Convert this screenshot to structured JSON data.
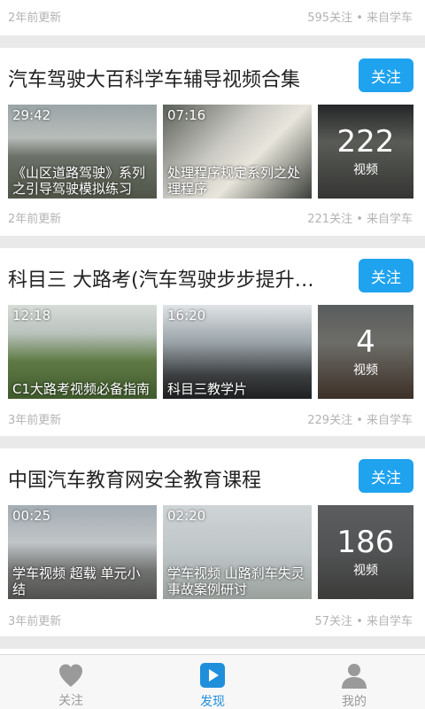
{
  "feed": {
    "top_partial": {
      "time": "2年前更新",
      "meta": "595关注 • 来自学车"
    },
    "cards": [
      {
        "title": "汽车驾驶大百科学车辅导视频合集",
        "follow_label": "关注",
        "videos": [
          {
            "duration": "29:42",
            "caption": "《山区道路驾驶》系列之引导驾驶模拟练习"
          },
          {
            "duration": "07:16",
            "caption": "处理程序规定系列之处理程序"
          }
        ],
        "count": {
          "number": "222",
          "label": "视频"
        },
        "time": "2年前更新",
        "meta": "221关注 • 来自学车"
      },
      {
        "title": "科目三 大路考(汽车驾驶步步提升…",
        "follow_label": "关注",
        "videos": [
          {
            "duration": "12:18",
            "caption": "C1大路考视频必备指南"
          },
          {
            "duration": "16:20",
            "caption": "科目三教学片"
          }
        ],
        "count": {
          "number": "4",
          "label": "视频"
        },
        "time": "3年前更新",
        "meta": "229关注 • 来自学车"
      },
      {
        "title": "中国汽车教育网安全教育课程",
        "follow_label": "关注",
        "videos": [
          {
            "duration": "00:25",
            "caption": "学车视频 超载 单元小结"
          },
          {
            "duration": "02:20",
            "caption": "学车视频 山路刹车失灵事故案例研讨"
          }
        ],
        "count": {
          "number": "186",
          "label": "视频"
        },
        "time": "3年前更新",
        "meta": "57关注 • 来自学车"
      }
    ]
  },
  "tabbar": {
    "tabs": [
      {
        "label": "关注",
        "icon": "heart-icon"
      },
      {
        "label": "发现",
        "icon": "play-icon"
      },
      {
        "label": "我的",
        "icon": "person-icon"
      }
    ],
    "active_color": "#1f8fdc",
    "inactive_color": "#9a9a9a"
  },
  "colors": {
    "accent": "#1fa3ef",
    "background": "#e9e9e9"
  }
}
